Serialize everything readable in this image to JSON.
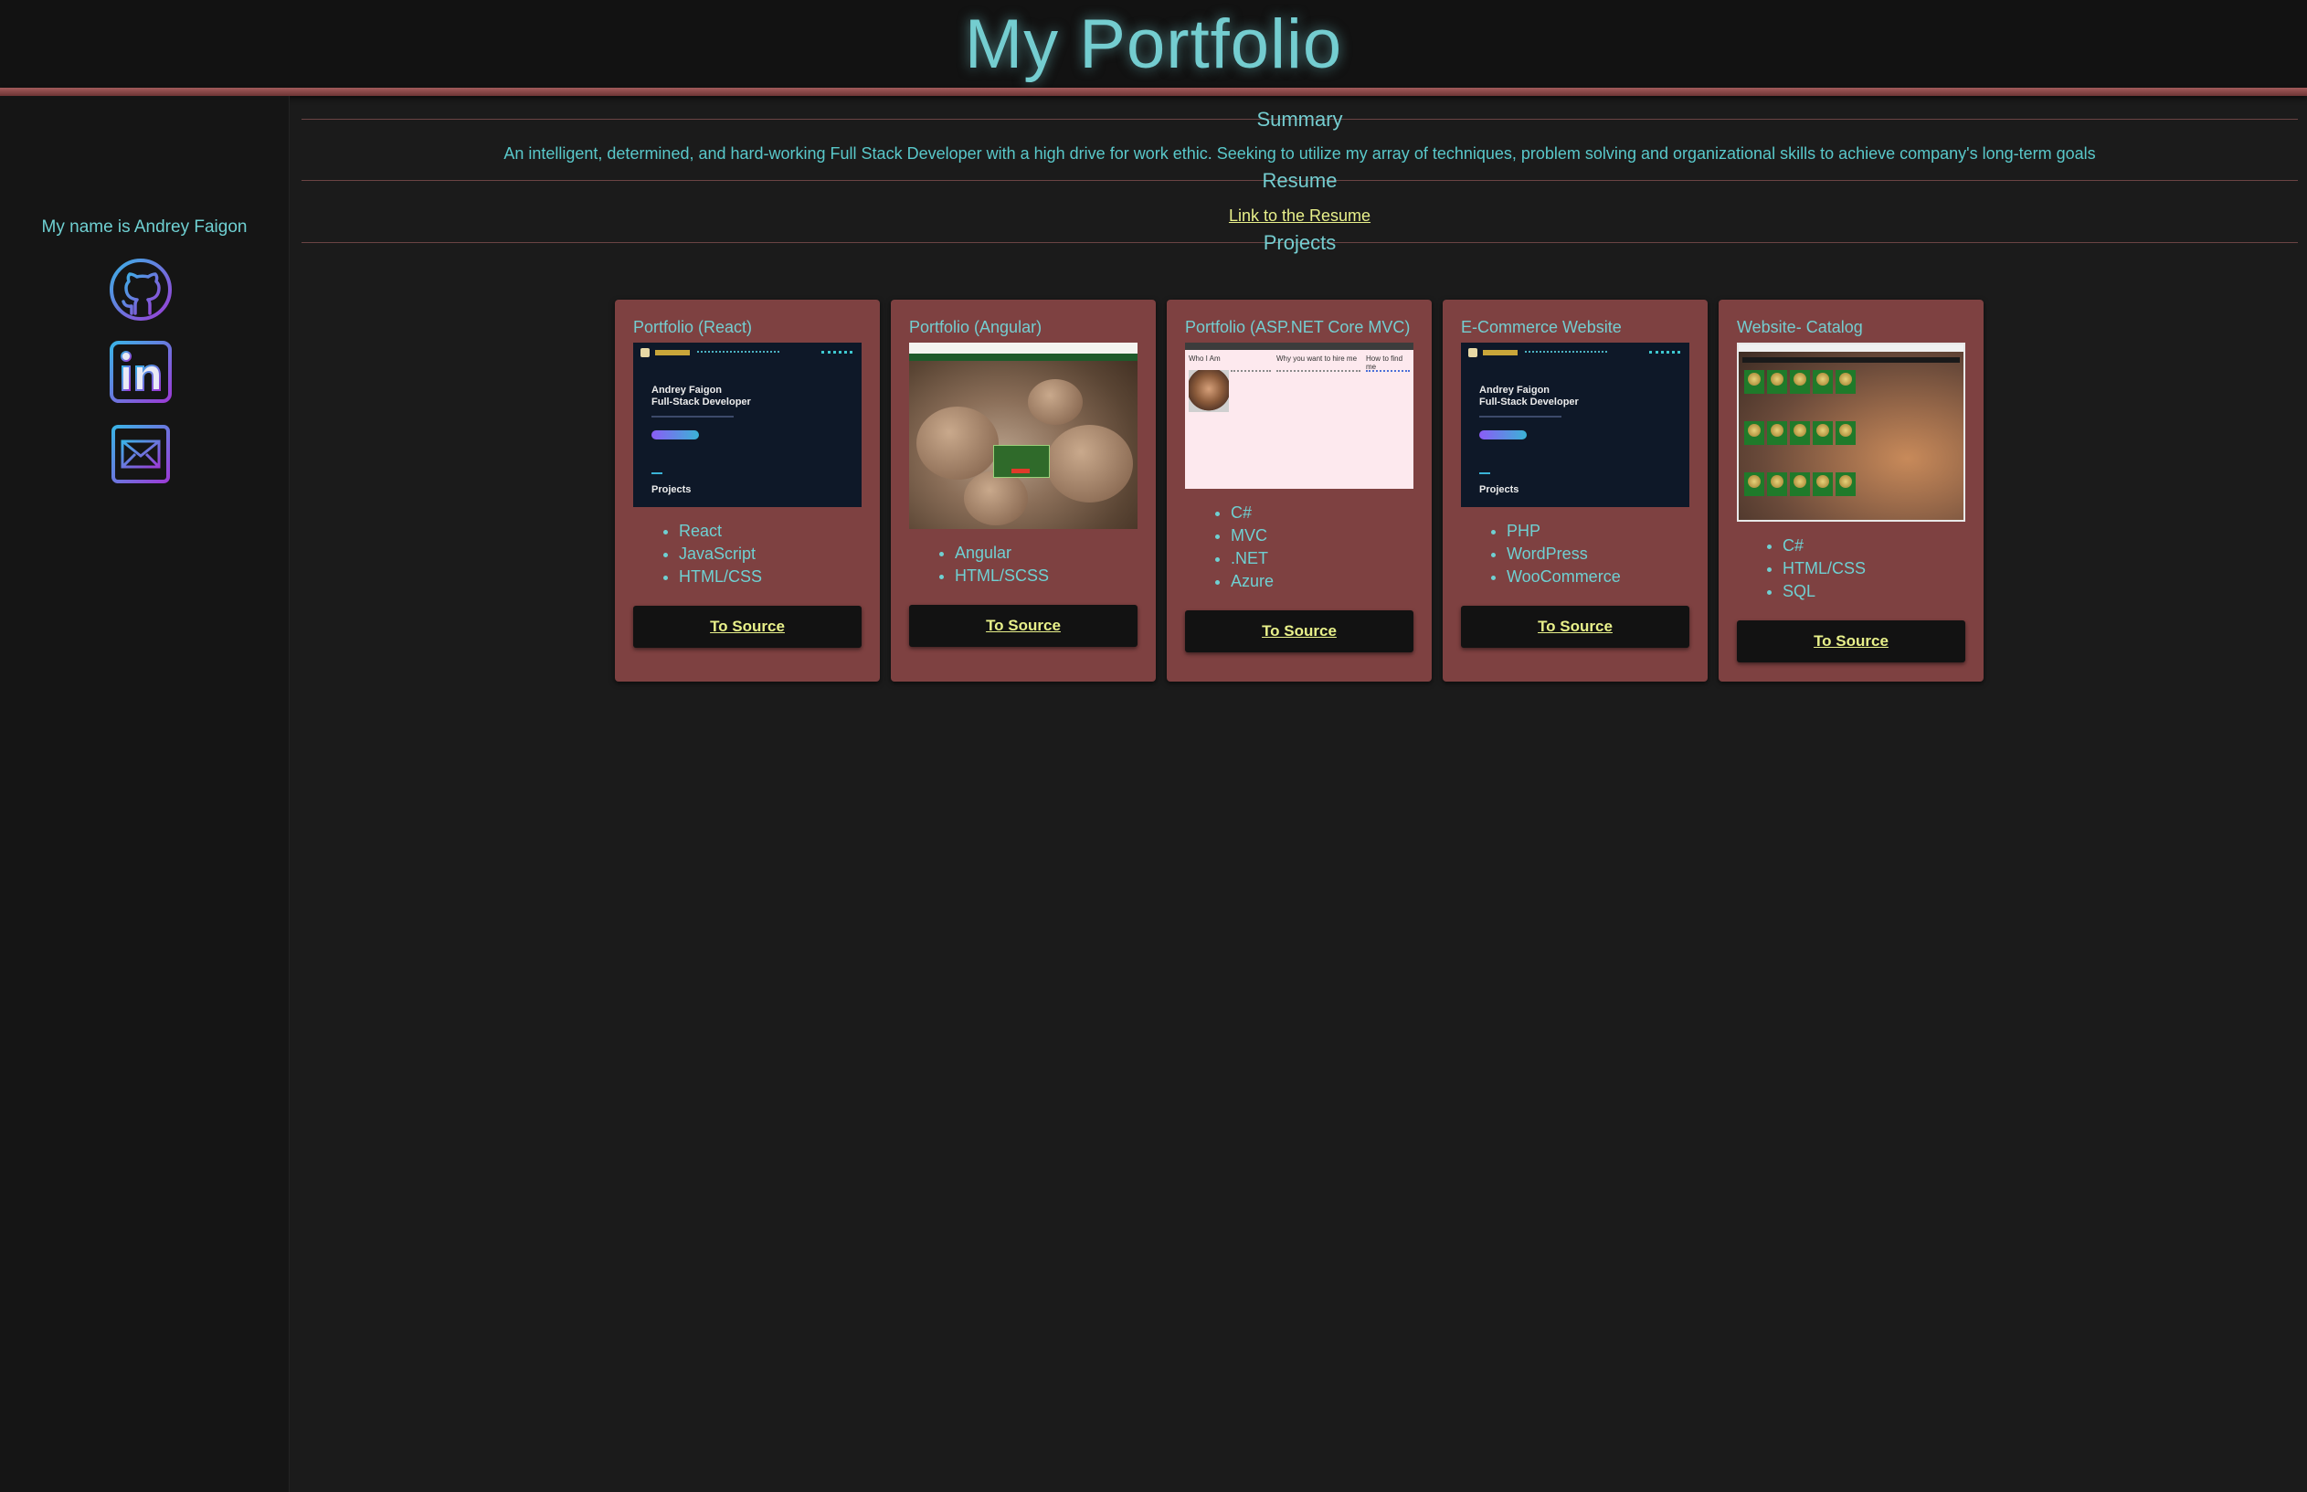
{
  "header": {
    "title": "My Portfolio"
  },
  "sidebar": {
    "name": "My name is Andrey Faigon",
    "links": [
      {
        "icon": "github-icon"
      },
      {
        "icon": "linkedin-icon"
      },
      {
        "icon": "email-icon"
      }
    ]
  },
  "summary": {
    "title": "Summary",
    "text": "An intelligent, determined, and hard-working Full Stack Developer with a high drive for work ethic. Seeking to utilize my array of techniques, problem solving and organizational skills to achieve company's long-term goals"
  },
  "resume": {
    "title": "Resume",
    "link_label": "Link to the Resume"
  },
  "projects": {
    "title": "Projects",
    "items": [
      {
        "title": "Portfolio (React)",
        "tech": [
          "React",
          "JavaScript",
          "HTML/CSS"
        ],
        "button": "To Source",
        "thumb": {
          "heading_line1": "Andrey Faigon",
          "heading_line2": "Full-Stack Developer",
          "section": "Projects"
        }
      },
      {
        "title": "Portfolio (Angular)",
        "tech": [
          "Angular",
          "HTML/SCSS"
        ],
        "button": "To Source"
      },
      {
        "title": "Portfolio (ASP.NET Core MVC)",
        "tech": [
          "C#",
          "MVC",
          ".NET",
          "Azure"
        ],
        "button": "To Source",
        "thumb": {
          "col1": "Who I Am",
          "col2": "Why you want to hire me",
          "col3": "How to find me"
        }
      },
      {
        "title": "E-Commerce Website",
        "tech": [
          "PHP",
          "WordPress",
          "WooCommerce"
        ],
        "button": "To Source",
        "thumb": {
          "heading_line1": "Andrey Faigon",
          "heading_line2": "Full-Stack Developer",
          "section": "Projects"
        }
      },
      {
        "title": "Website- Catalog",
        "tech": [
          "C#",
          "HTML/CSS",
          "SQL"
        ],
        "button": "To Source"
      }
    ]
  },
  "colors": {
    "accent": "#74cdd0",
    "card": "#7e4141",
    "link": "#e8f08a",
    "background": "#1b1b1b"
  }
}
